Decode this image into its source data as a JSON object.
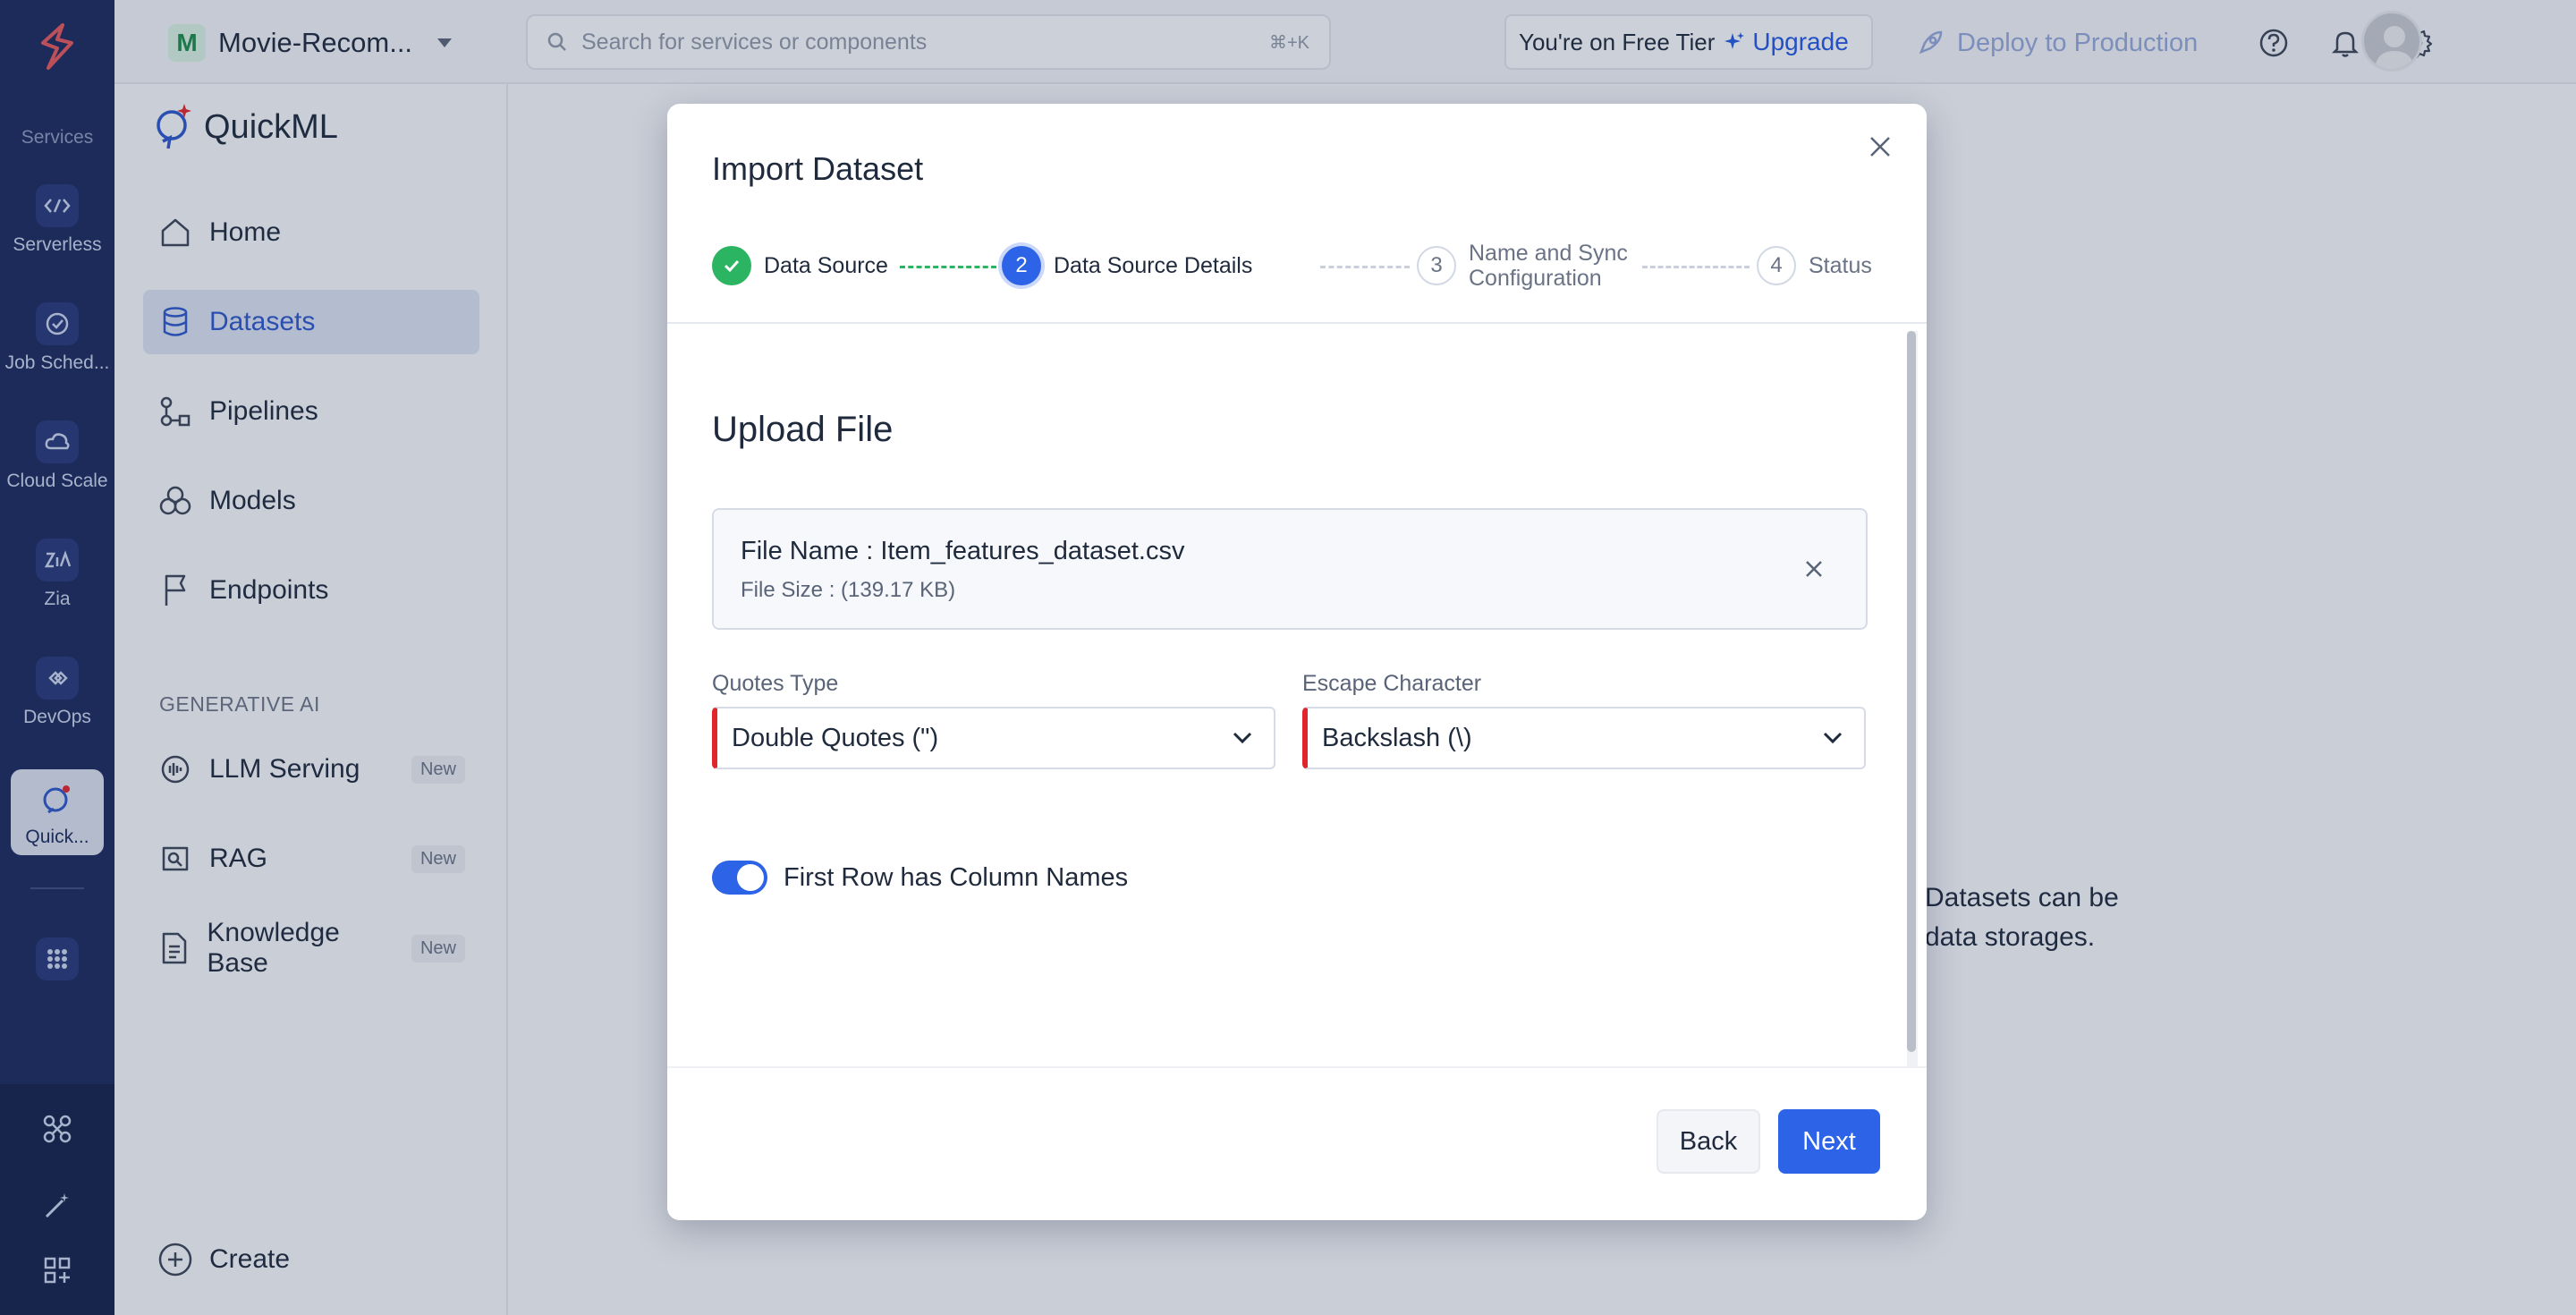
{
  "rail": {
    "section_label": "Services",
    "items": [
      {
        "label": "Serverless",
        "icon": "serverless-icon"
      },
      {
        "label": "Job Sched...",
        "icon": "job-scheduling-icon"
      },
      {
        "label": "Cloud Scale",
        "icon": "cloud-scale-icon"
      },
      {
        "label": "Zia",
        "icon": "zia-icon"
      },
      {
        "label": "DevOps",
        "icon": "devops-icon"
      }
    ],
    "active_item": {
      "label": "Quick...",
      "icon": "quickml-icon"
    }
  },
  "topbar": {
    "project_initial": "M",
    "project_name": "Movie-Recom...",
    "search_placeholder": "Search for services or components",
    "search_shortcut": "⌘+K",
    "tier_text": "You're on Free Tier",
    "upgrade_label": "Upgrade",
    "deploy_label": "Deploy to Production"
  },
  "sidebar": {
    "brand": "QuickML",
    "items": [
      {
        "label": "Home"
      },
      {
        "label": "Datasets"
      },
      {
        "label": "Pipelines"
      },
      {
        "label": "Models"
      },
      {
        "label": "Endpoints"
      }
    ],
    "gen_ai_heading": "GENERATIVE AI",
    "gen_items": [
      {
        "label": "LLM Serving",
        "badge": "New"
      },
      {
        "label": "RAG",
        "badge": "New"
      },
      {
        "label": "Knowledge Base",
        "badge": "New"
      }
    ],
    "create_label": "Create"
  },
  "background": {
    "text_line1": "Datasets can be",
    "text_line2": "data storages."
  },
  "modal": {
    "title": "Import Dataset",
    "steps": [
      {
        "number": "✓",
        "label": "Data Source",
        "state": "done"
      },
      {
        "number": "2",
        "label": "Data Source Details",
        "state": "current"
      },
      {
        "number": "3",
        "label_line1": "Name and Sync",
        "label_line2": "Configuration",
        "state": "pending"
      },
      {
        "number": "4",
        "label": "Status",
        "state": "pending"
      }
    ],
    "section_title": "Upload File",
    "file_name": "File Name : Item_features_dataset.csv",
    "file_size": "File Size : (139.17 KB)",
    "quotes_label": "Quotes Type",
    "quotes_value": "Double Quotes (\")",
    "escape_label": "Escape Character",
    "escape_value": "Backslash (\\)",
    "toggle_label": "First Row has Column Names",
    "toggle_on": true,
    "back_label": "Back",
    "next_label": "Next"
  },
  "colors": {
    "accent": "#2d63e6",
    "rail": "#1b2a5c",
    "success": "#2bb461",
    "required": "#e0262c"
  }
}
